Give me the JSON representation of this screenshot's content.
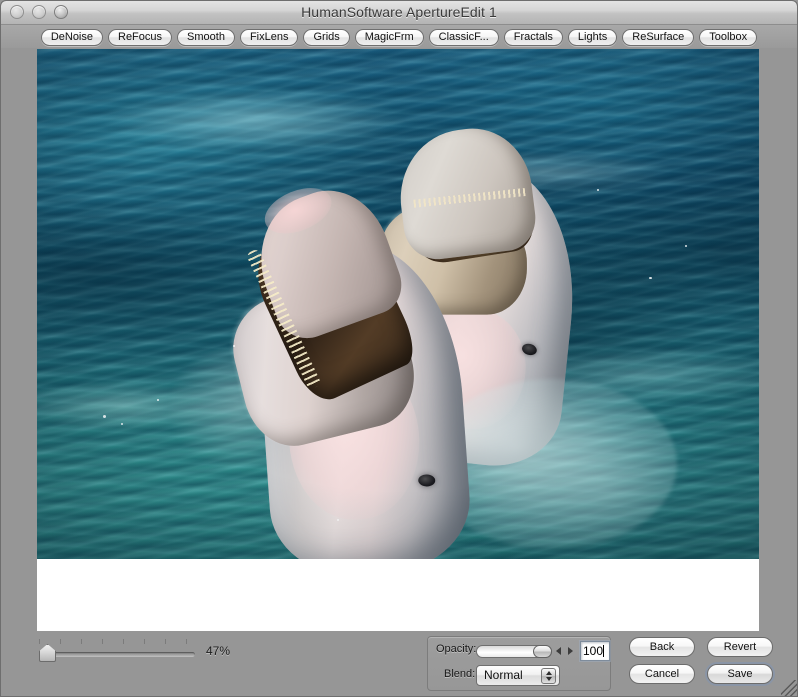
{
  "window": {
    "title": "HumanSoftware ApertureEdit 1",
    "controls": {
      "close_label": "close-button",
      "minimize_label": "minimize-button",
      "zoom_label": "zoom-button"
    }
  },
  "toolbar": {
    "buttons": [
      {
        "label": "DeNoise"
      },
      {
        "label": "ReFocus"
      },
      {
        "label": "Smooth"
      },
      {
        "label": "FixLens"
      },
      {
        "label": "Grids"
      },
      {
        "label": "MagicFrm"
      },
      {
        "label": "ClassicF..."
      },
      {
        "label": "Fractals"
      },
      {
        "label": "Lights"
      },
      {
        "label": "ReSurface"
      },
      {
        "label": "Toolbox"
      }
    ]
  },
  "canvas": {
    "image_description": "Two bottlenose dolphins surfacing with open mouths in blue-green ocean water",
    "background_color": "#ffffff"
  },
  "zoom_control": {
    "value_label": "47%",
    "percent": 47,
    "min": 0,
    "max": 100,
    "tick_count": 8
  },
  "opacity_panel": {
    "opacity_label": "Opacity:",
    "opacity_value": "100",
    "opacity_min": 0,
    "opacity_max": 100,
    "decrement_icon": "triangle-left-icon",
    "increment_icon": "triangle-right-icon",
    "blend_label": "Blend:",
    "blend_value": "Normal",
    "blend_options": [
      "Normal"
    ],
    "stepper_icon": "stepper-up-down-icon"
  },
  "actions": {
    "back": "Back",
    "revert": "Revert",
    "cancel": "Cancel",
    "save": "Save",
    "default_button": "Save"
  },
  "resize_grip": {
    "icon": "resize-grip-icon"
  },
  "colors": {
    "window_chrome": "#969696",
    "titlebar_top": "#e4e4e4",
    "titlebar_bottom": "#b4b4b4",
    "toolbar_bg": "#9e9e9e",
    "canvas_white": "#ffffff",
    "default_button_glow": "#8296b4",
    "text": "#1a1a1a"
  }
}
